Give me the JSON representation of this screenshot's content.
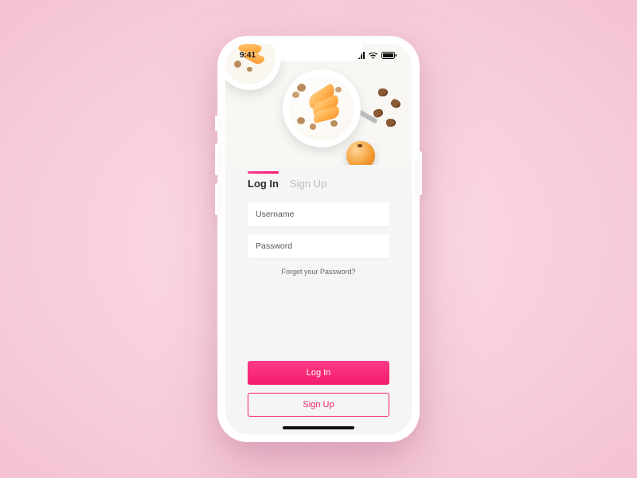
{
  "statusbar": {
    "time": "9:41"
  },
  "tabs": {
    "login": "Log In",
    "signup": "Sign Up"
  },
  "form": {
    "username_placeholder": "Username",
    "password_placeholder": "Password",
    "forgot": "Forget your Password?"
  },
  "buttons": {
    "login": "Log In",
    "signup": "Sign Up"
  },
  "colors": {
    "accent": "#f21c6c"
  }
}
